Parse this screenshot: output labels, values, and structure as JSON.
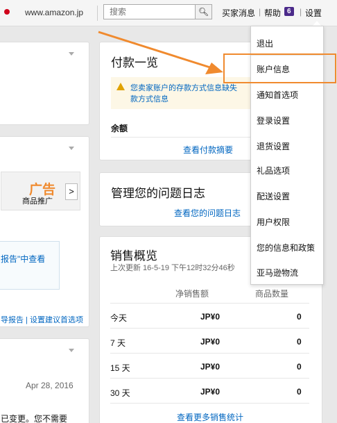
{
  "topbar": {
    "site": "www.amazon.jp",
    "search_placeholder": "搜索",
    "buyer_messages": "买家消息",
    "help": "帮助",
    "help_badge": "6",
    "settings": "设置"
  },
  "left": {
    "ad_title": "广告",
    "ad_subtitle": "商品推广",
    "arrow": ">",
    "report_fragment": "报告\"中查看",
    "links_fragment": "导报告 | 设置建议首选项",
    "date": "Apr 28, 2016",
    "bottom_fragment": "已变更。您不需要"
  },
  "payments": {
    "title": "付款一览",
    "warning_line1": "您卖家账户的存款方式信息缺失",
    "warning_line2": "款方式信息",
    "balance_label": "余额",
    "view_summary": "查看付款摘要"
  },
  "issues": {
    "title": "管理您的问题日志",
    "view_log": "查看您的问题日志"
  },
  "sales": {
    "title": "销售概览",
    "updated": "上次更新 16-5-19 下午12时32分46秒",
    "col_net": "净销售额",
    "col_units": "商品数量",
    "rows": [
      {
        "period": "今天",
        "net": "JP¥0",
        "units": "0"
      },
      {
        "period": "7 天",
        "net": "JP¥0",
        "units": "0"
      },
      {
        "period": "15 天",
        "net": "JP¥0",
        "units": "0"
      },
      {
        "period": "30 天",
        "net": "JP¥0",
        "units": "0"
      }
    ],
    "more": "查看更多销售统计"
  },
  "menu": {
    "items": [
      "退出",
      "账户信息",
      "通知首选项",
      "登录设置",
      "退货设置",
      "礼品选项",
      "配送设置",
      "用户权限",
      "您的信息和政策",
      "亚马逊物流"
    ]
  },
  "colors": {
    "accent_orange": "#f08a2e",
    "link_blue": "#0066c0",
    "badge_purple": "#4b2a8a"
  }
}
